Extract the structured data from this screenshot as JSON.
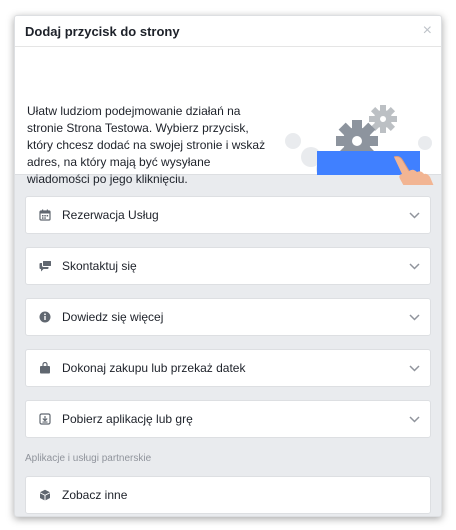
{
  "dialog": {
    "title": "Dodaj przycisk do strony",
    "close_glyph": "×"
  },
  "intro": {
    "text": "Ułatw ludziom podejmowanie działań na stronie Strona Testowa. Wybierz przycisk, który chcesz dodać na swojej stronie i wskaż adres, na który mają być wysyłane wiadomości po jego kliknięciu."
  },
  "options": [
    {
      "label": "Rezerwacja Usług",
      "icon": "calendar-icon"
    },
    {
      "label": "Skontaktuj się",
      "icon": "chat-icon"
    },
    {
      "label": "Dowiedz się więcej",
      "icon": "info-icon"
    },
    {
      "label": "Dokonaj zakupu lub przekaż datek",
      "icon": "shopping-bag-icon"
    },
    {
      "label": "Pobierz aplikację lub grę",
      "icon": "download-icon"
    }
  ],
  "partners": {
    "section_label": "Aplikacje i usługi partnerskie",
    "more_label": "Zobacz inne",
    "more_icon": "cube-icon"
  },
  "colors": {
    "accent_blue": "#4080ff",
    "icon_gray": "#606770",
    "chevron_gray": "#90949c"
  }
}
